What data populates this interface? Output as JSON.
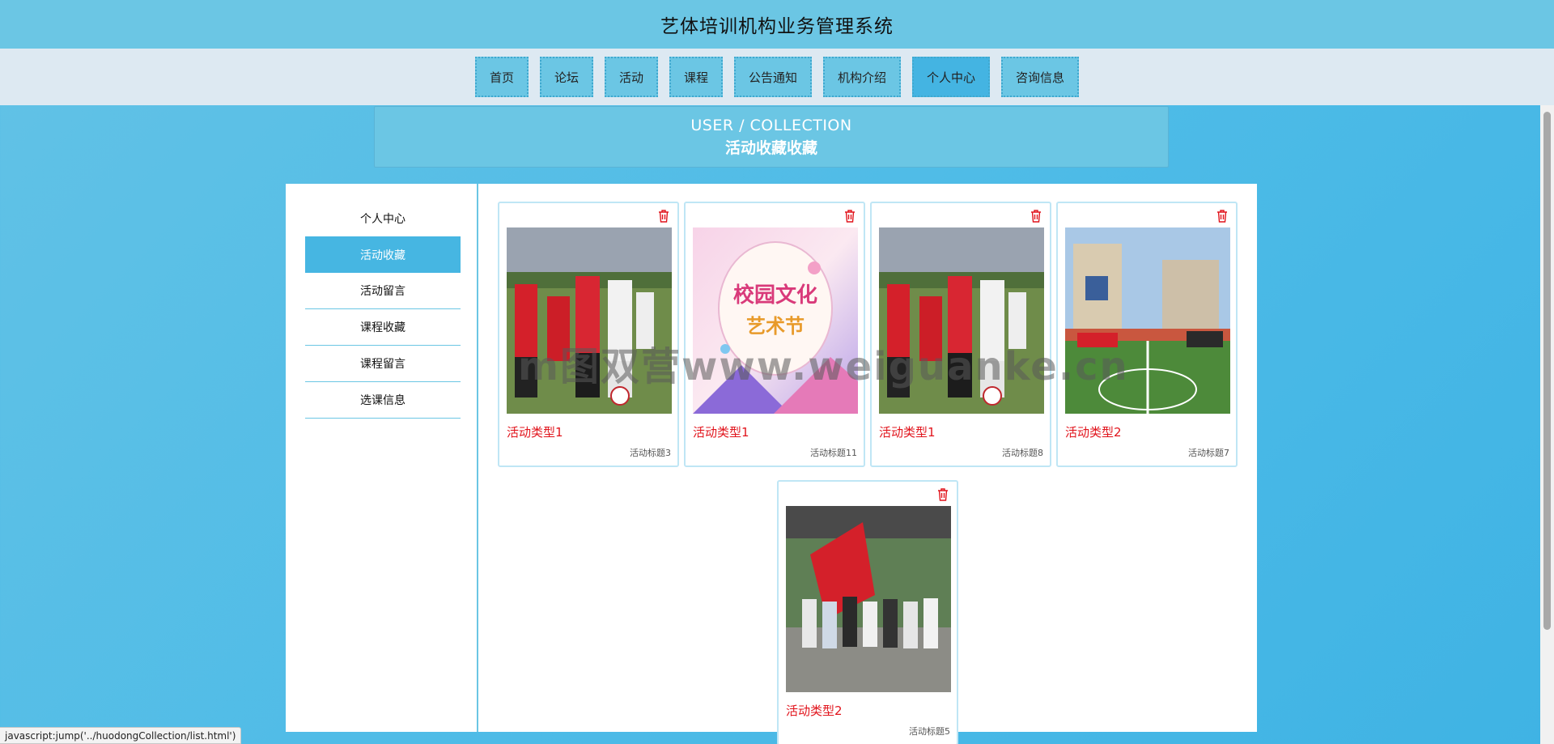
{
  "header": {
    "title": "艺体培训机构业务管理系统"
  },
  "nav": {
    "items": [
      {
        "label": "首页"
      },
      {
        "label": "论坛"
      },
      {
        "label": "活动"
      },
      {
        "label": "课程"
      },
      {
        "label": "公告通知"
      },
      {
        "label": "机构介绍"
      },
      {
        "label": "个人中心",
        "active": true
      },
      {
        "label": "咨询信息"
      }
    ]
  },
  "banner": {
    "en": "USER / COLLECTION",
    "cn": "活动收藏收藏"
  },
  "sidebar": {
    "items": [
      {
        "label": "个人中心"
      },
      {
        "label": "活动收藏",
        "active": true
      },
      {
        "label": "活动留言"
      },
      {
        "label": "课程收藏"
      },
      {
        "label": "课程留言"
      },
      {
        "label": "选课信息"
      }
    ]
  },
  "cards": [
    {
      "type": "活动类型1",
      "title": "活动标题3",
      "image": "soccer-kids-photo"
    },
    {
      "type": "活动类型1",
      "title": "活动标题11",
      "image": "campus-art-festival-poster",
      "poster_text": "校园文化 艺术节"
    },
    {
      "type": "活动类型1",
      "title": "活动标题8",
      "image": "soccer-kids-photo"
    },
    {
      "type": "活动类型2",
      "title": "活动标题7",
      "image": "sports-field-ceremony-photo"
    },
    {
      "type": "活动类型2",
      "title": "活动标题5",
      "image": "group-with-flag-photo"
    }
  ],
  "colors": {
    "accent": "#46b6e2",
    "type_text": "#e1141c",
    "header_bg": "#6bc6e4"
  },
  "icons": {
    "delete": "trash-icon"
  },
  "watermark": "m图双营www.weiguanke.cn",
  "statusbar": {
    "text": "javascript:jump('../huodongCollection/list.html')"
  }
}
